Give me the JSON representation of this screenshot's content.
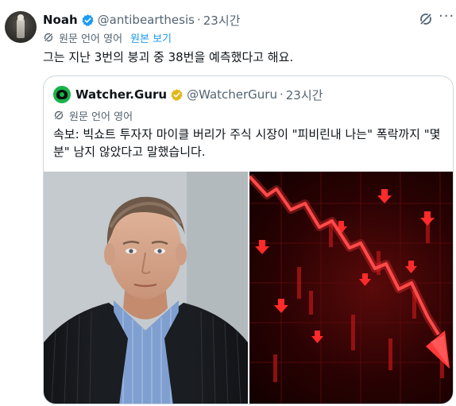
{
  "tweet": {
    "author_name": "Noah",
    "author_handle": "@antibearthesis",
    "separator": "·",
    "time": "23시간",
    "translate_label": "원문 언어 영어",
    "show_original": "원본 보기",
    "text": "그는 지난 3번의 붕괴 중 38번을 예측했다고 해요."
  },
  "quote": {
    "author_name": "Watcher.Guru",
    "author_handle": "@WatcherGuru",
    "separator": "·",
    "time": "23시간",
    "translate_label": "원문 언어 영어",
    "text": "속보: 빅쇼트 투자자 마이클 버리가 주식 시장이 \"피비린내 나는\" 폭락까지 \"몇 분\" 남지 않았다고 말했습니다."
  },
  "colors": {
    "accent": "#1d9bf0",
    "verified_blue": "#1d9bf0",
    "gold_badge": "#e2b719",
    "muted_text": "#536471",
    "crash_red": "#ff2a2a"
  },
  "icons": {
    "verified": "verified-badge-icon",
    "grok": "grok-icon",
    "more": "more-icon",
    "translate": "translate-icon",
    "gold": "gold-verified-icon"
  }
}
